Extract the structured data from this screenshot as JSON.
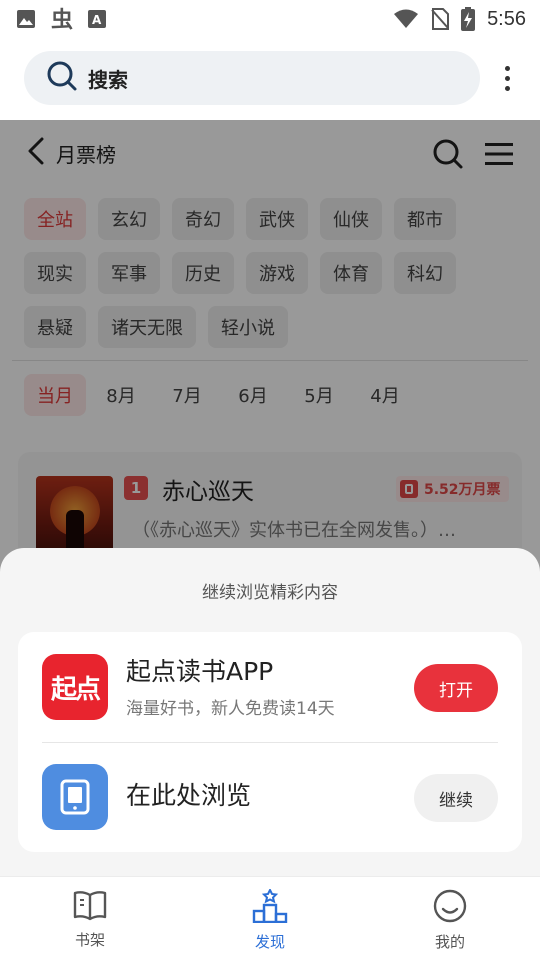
{
  "status_bar": {
    "time": "5:56",
    "left_icons": [
      "image-icon",
      "bug-icon",
      "font-icon"
    ],
    "right_icons": [
      "wifi-icon",
      "no-sim-icon",
      "battery-charging-icon"
    ]
  },
  "top_bar": {
    "search_label": "搜索",
    "more_icon": "more-vertical-icon"
  },
  "page": {
    "back_icon": "chevron-left-icon",
    "title": "月票榜",
    "categories_row1": [
      "全站",
      "玄幻",
      "奇幻",
      "武侠",
      "仙侠",
      "都市"
    ],
    "categories_row2": [
      "现实",
      "军事",
      "历史",
      "游戏",
      "体育",
      "科幻"
    ],
    "categories_row3": [
      "悬疑",
      "诸天无限",
      "轻小说"
    ],
    "active_category": "全站",
    "months": [
      "当月",
      "8月",
      "7月",
      "6月",
      "5月",
      "4月"
    ],
    "active_month": "当月",
    "book": {
      "rank": "1",
      "title": "赤心巡天",
      "tickets": "5.52万月票",
      "description": "（《赤心巡天》实体书已在全网发售。）…"
    }
  },
  "sheet": {
    "title": "继续浏览精彩内容",
    "app_option": {
      "icon_text": "起点",
      "name": "起点读书APP",
      "subtitle": "海量好书，新人免费读14天",
      "button": "打开"
    },
    "browser_option": {
      "name": "在此处浏览",
      "button": "继续"
    }
  },
  "tab_bar": {
    "tabs": [
      {
        "label": "书架",
        "icon": "book-open-icon",
        "active": false
      },
      {
        "label": "发现",
        "icon": "podium-icon",
        "active": true
      },
      {
        "label": "我的",
        "icon": "smile-icon",
        "active": false
      }
    ]
  },
  "colors": {
    "accent_red": "#e8323c",
    "active_tab_blue": "#2c6fd6",
    "browse_icon_blue": "#4f8de0"
  }
}
